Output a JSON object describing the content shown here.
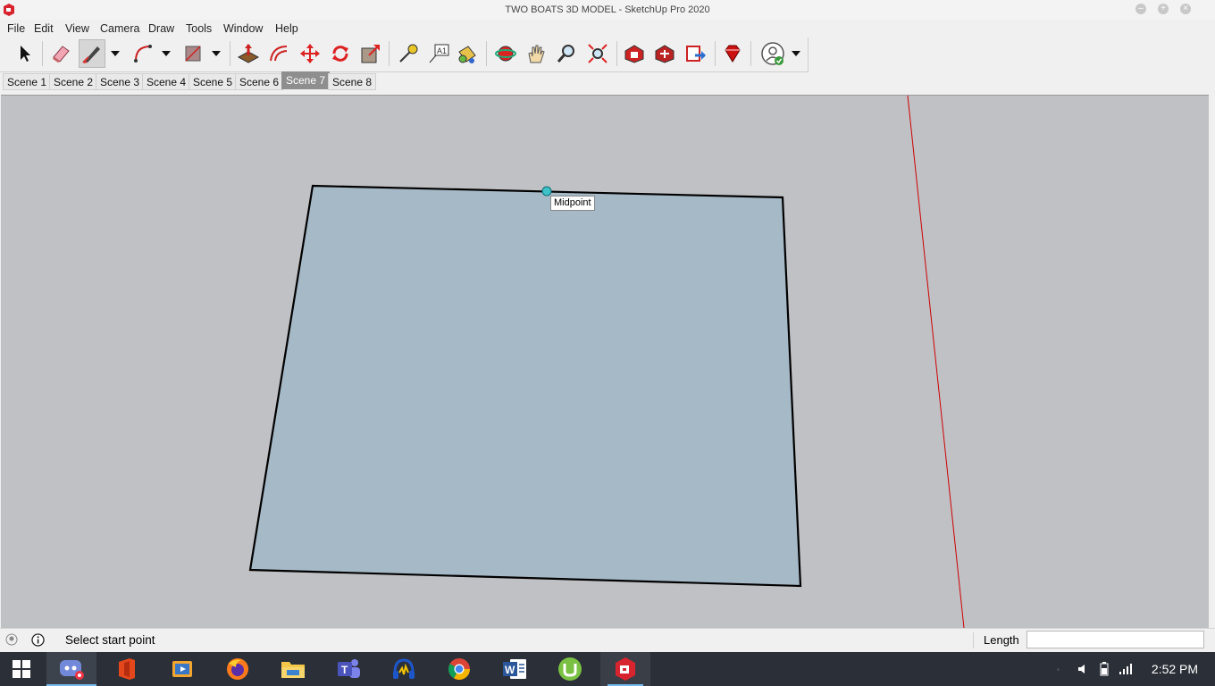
{
  "window": {
    "title": "TWO BOATS 3D MODEL - SketchUp Pro 2020",
    "controls": [
      "minimize-icon",
      "maximize-icon",
      "close-icon"
    ]
  },
  "menu": [
    "File",
    "Edit",
    "View",
    "Camera",
    "Draw",
    "Tools",
    "Window",
    "Help"
  ],
  "toolbar": {
    "tools": [
      {
        "name": "select-tool",
        "icon": "cursor-arrow-icon"
      },
      {
        "name": "eraser-tool",
        "icon": "eraser-icon"
      },
      {
        "name": "line-tool",
        "icon": "pencil-icon",
        "active": true
      },
      {
        "name": "arc-tool",
        "icon": "arc-icon"
      },
      {
        "name": "rectangle-tool",
        "icon": "rectangle-icon"
      },
      {
        "name": "push-pull-tool",
        "icon": "push-pull-icon"
      },
      {
        "name": "offset-tool",
        "icon": "offset-icon"
      },
      {
        "name": "move-tool",
        "icon": "move-icon"
      },
      {
        "name": "rotate-tool",
        "icon": "rotate-icon"
      },
      {
        "name": "scale-tool",
        "icon": "scale-icon"
      },
      {
        "name": "tape-measure-tool",
        "icon": "tape-measure-icon"
      },
      {
        "name": "text-tool",
        "icon": "text-icon"
      },
      {
        "name": "paint-bucket-tool",
        "icon": "paint-bucket-icon"
      },
      {
        "name": "orbit-tool",
        "icon": "orbit-icon"
      },
      {
        "name": "pan-tool",
        "icon": "pan-hand-icon"
      },
      {
        "name": "zoom-tool",
        "icon": "zoom-magnifier-icon"
      },
      {
        "name": "zoom-extents-tool",
        "icon": "zoom-extents-icon"
      },
      {
        "name": "3d-warehouse-tool",
        "icon": "warehouse-icon"
      },
      {
        "name": "extension-warehouse-tool",
        "icon": "extension-warehouse-icon"
      },
      {
        "name": "send-to-layout-tool",
        "icon": "send-to-layout-icon"
      },
      {
        "name": "extension-manager-tool",
        "icon": "ruby-gem-icon"
      },
      {
        "name": "account-tool",
        "icon": "account-check-icon"
      }
    ]
  },
  "scenes": {
    "tabs": [
      "Scene 1",
      "Scene 2",
      "Scene 3",
      "Scene 4",
      "Scene 5",
      "Scene 6",
      "Scene 7",
      "Scene 8"
    ],
    "active": "Scene 7"
  },
  "viewport": {
    "inference_tooltip": "Midpoint",
    "background": "#c0c1c5",
    "face_color": "#a6b9c7",
    "red_axis_color": "#cc0000",
    "inference_point_color": "#3ec1c9"
  },
  "status": {
    "message": "Select start point",
    "measurement_label": "Length",
    "measurement_value": ""
  },
  "taskbar": {
    "apps": [
      {
        "name": "discord",
        "icon": "discord-icon",
        "active": true
      },
      {
        "name": "office",
        "icon": "office-icon"
      },
      {
        "name": "media-player",
        "icon": "video-player-icon"
      },
      {
        "name": "firefox",
        "icon": "firefox-icon"
      },
      {
        "name": "file-explorer",
        "icon": "folder-icon"
      },
      {
        "name": "teams",
        "icon": "teams-icon"
      },
      {
        "name": "audio-app",
        "icon": "headphones-icon"
      },
      {
        "name": "chrome",
        "icon": "chrome-icon"
      },
      {
        "name": "word",
        "icon": "word-icon"
      },
      {
        "name": "utorrent",
        "icon": "utorrent-icon"
      },
      {
        "name": "sketchup",
        "icon": "sketchup-icon",
        "open": true
      }
    ],
    "clock": "2:52 PM"
  }
}
